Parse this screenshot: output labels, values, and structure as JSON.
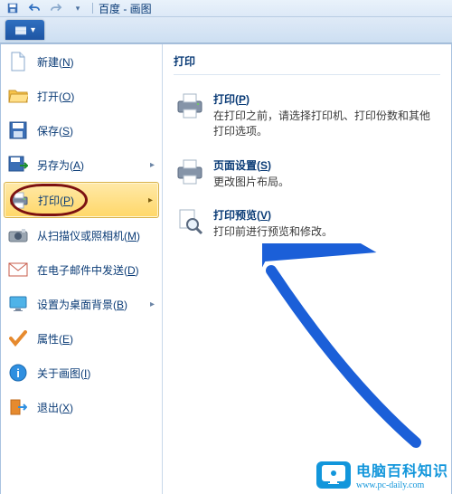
{
  "titlebar": {
    "title": "百度 - 画图"
  },
  "file_tab": {
    "glyph": "▾"
  },
  "left": {
    "new": "新建(<u>N</u>)",
    "open": "打开(<u>O</u>)",
    "save": "保存(<u>S</u>)",
    "saveas": "另存为(<u>A</u>)",
    "print": "打印(<u>P</u>)",
    "scanner": "从扫描仪或照相机(<u>M</u>)",
    "email": "在电子邮件中发送(<u>D</u>)",
    "wallpaper": "设置为桌面背景(<u>B</u>)",
    "properties": "属性(<u>E</u>)",
    "about": "关于画图(<u>I</u>)",
    "exit": "退出(<u>X</u>)"
  },
  "right": {
    "heading": "打印",
    "print": {
      "title": "打印(<u>P</u>)",
      "desc": "在打印之前，请选择打印机、打印份数和其他打印选项。"
    },
    "pagesetup": {
      "title": "页面设置(<u>S</u>)",
      "desc": "更改图片布局。"
    },
    "preview": {
      "title": "打印预览(<u>V</u>)",
      "desc": "打印前进行预览和修改。"
    }
  },
  "watermark": {
    "line1": "电脑百科知识",
    "line2": "www.pc-daily.com"
  }
}
